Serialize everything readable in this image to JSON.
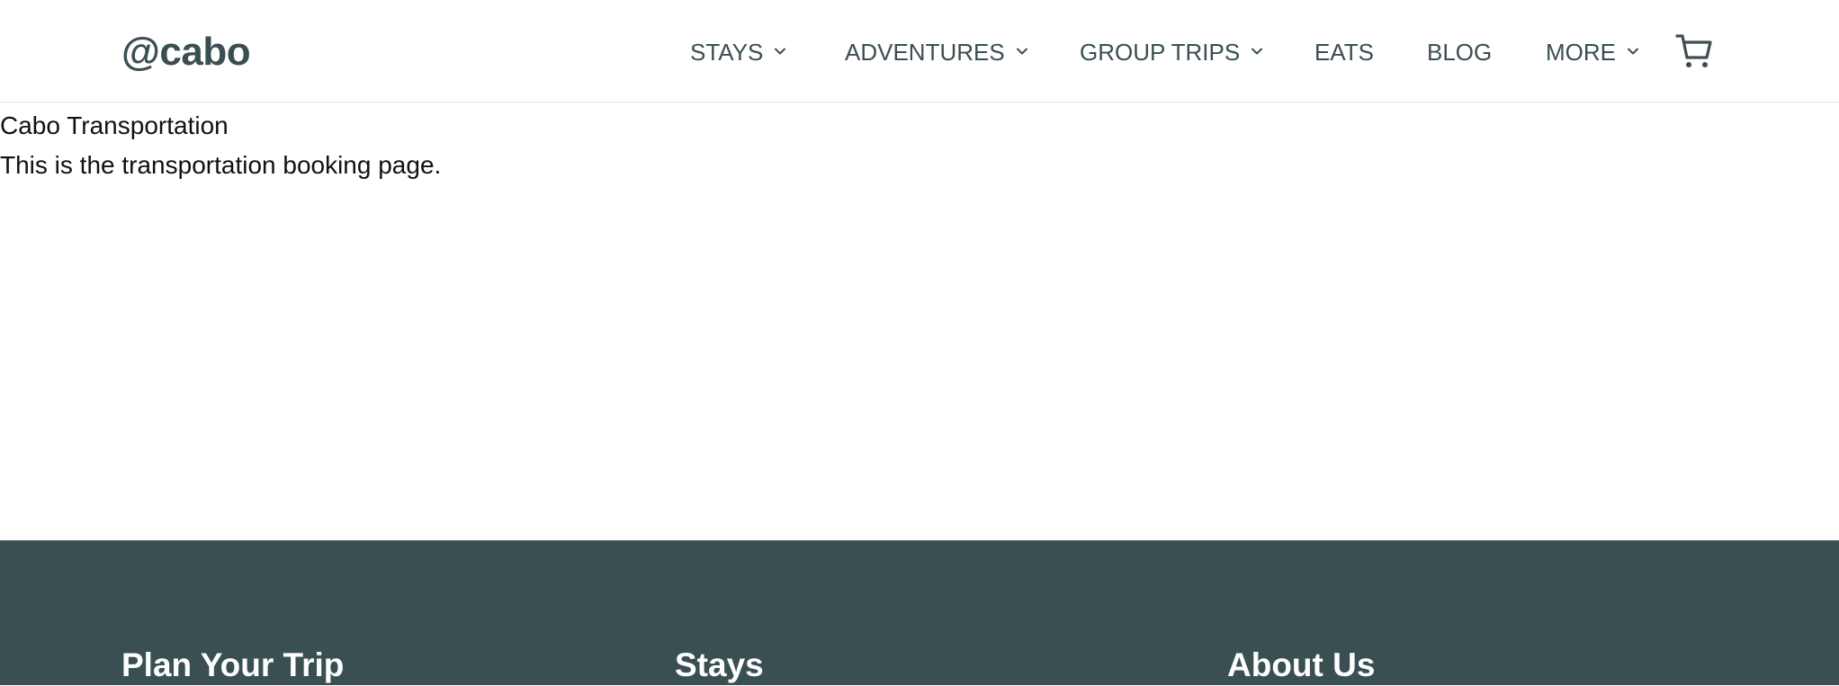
{
  "header": {
    "logo": "@cabo",
    "nav": [
      {
        "label": "STAYS",
        "dropdown": true
      },
      {
        "label": "ADVENTURES",
        "dropdown": true
      },
      {
        "label": "GROUP TRIPS",
        "dropdown": true
      },
      {
        "label": "EATS",
        "dropdown": false
      },
      {
        "label": "BLOG",
        "dropdown": false
      },
      {
        "label": "MORE",
        "dropdown": true
      }
    ],
    "cart_icon": "shopping-cart-icon"
  },
  "main": {
    "title": "Cabo Transportation",
    "description": "This is the transportation booking page."
  },
  "footer": {
    "columns": [
      {
        "heading": "Plan Your Trip"
      },
      {
        "heading": "Stays"
      },
      {
        "heading": "About Us"
      }
    ]
  },
  "colors": {
    "brand": "#3a4f52",
    "background": "#ffffff",
    "footer_bg": "#3a4f52",
    "footer_text": "#ffffff"
  }
}
